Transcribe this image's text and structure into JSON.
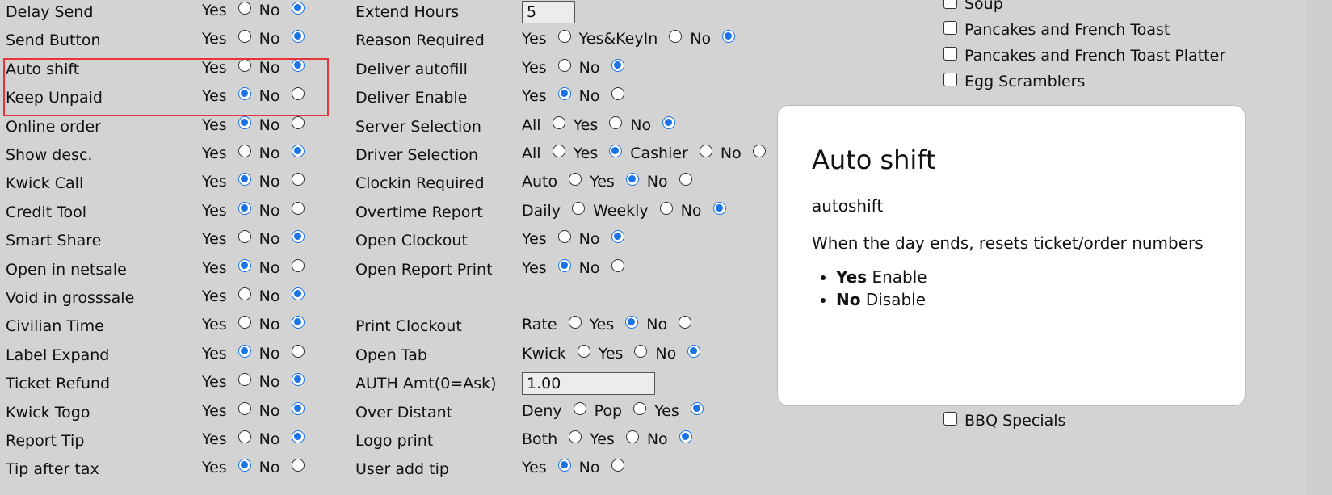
{
  "left_rows": [
    {
      "label": "Delay Send",
      "yes": "Yes",
      "no": "No",
      "selected": "no"
    },
    {
      "label": "Send Button",
      "yes": "Yes",
      "no": "No",
      "selected": "no"
    },
    {
      "label": "Auto shift",
      "yes": "Yes",
      "no": "No",
      "selected": "no"
    },
    {
      "label": "Keep Unpaid",
      "yes": "Yes",
      "no": "No",
      "selected": "yes"
    },
    {
      "label": "Online order",
      "yes": "Yes",
      "no": "No",
      "selected": "yes"
    },
    {
      "label": "Show desc.",
      "yes": "Yes",
      "no": "No",
      "selected": "no"
    },
    {
      "label": "Kwick Call",
      "yes": "Yes",
      "no": "No",
      "selected": "yes"
    },
    {
      "label": "Credit Tool",
      "yes": "Yes",
      "no": "No",
      "selected": "yes"
    },
    {
      "label": "Smart Share",
      "yes": "Yes",
      "no": "No",
      "selected": "no"
    },
    {
      "label": "Open in netsale",
      "yes": "Yes",
      "no": "No",
      "selected": "yes"
    },
    {
      "label": "Void in grosssale",
      "yes": "Yes",
      "no": "No",
      "selected": "no"
    },
    {
      "label": "Civilian Time",
      "yes": "Yes",
      "no": "No",
      "selected": "no"
    },
    {
      "label": "Label Expand",
      "yes": "Yes",
      "no": "No",
      "selected": "yes"
    },
    {
      "label": "Ticket Refund",
      "yes": "Yes",
      "no": "No",
      "selected": "no"
    },
    {
      "label": "Kwick Togo",
      "yes": "Yes",
      "no": "No",
      "selected": "no"
    },
    {
      "label": "Report Tip",
      "yes": "Yes",
      "no": "No",
      "selected": "no"
    },
    {
      "label": "Tip after tax",
      "yes": "Yes",
      "no": "No",
      "selected": "yes"
    }
  ],
  "mid_rows": [
    {
      "label": "Extend Hours",
      "input": "5",
      "options": []
    },
    {
      "label": "Reason Required",
      "options": [
        {
          "label": "Yes",
          "on": false
        },
        {
          "label": "Yes&KeyIn",
          "on": false
        },
        {
          "label": "No",
          "on": true
        }
      ]
    },
    {
      "label": "Deliver autofill",
      "options": [
        {
          "label": "Yes",
          "on": false
        },
        {
          "label": "No",
          "on": true
        }
      ]
    },
    {
      "label": "Deliver Enable",
      "options": [
        {
          "label": "Yes",
          "on": true
        },
        {
          "label": "No",
          "on": false
        }
      ]
    },
    {
      "label": "Server Selection",
      "options": [
        {
          "label": "All",
          "on": false
        },
        {
          "label": "Yes",
          "on": false
        },
        {
          "label": "No",
          "on": true
        }
      ]
    },
    {
      "label": "Driver Selection",
      "options": [
        {
          "label": "All",
          "on": false
        },
        {
          "label": "Yes",
          "on": true
        },
        {
          "label": "Cashier",
          "on": false
        },
        {
          "label": "No",
          "on": false
        }
      ]
    },
    {
      "label": "Clockin Required",
      "options": [
        {
          "label": "Auto",
          "on": false
        },
        {
          "label": "Yes",
          "on": true
        },
        {
          "label": "No",
          "on": false
        }
      ]
    },
    {
      "label": "Overtime Report",
      "options": [
        {
          "label": "Daily",
          "on": false
        },
        {
          "label": "Weekly",
          "on": false
        },
        {
          "label": "No",
          "on": true
        }
      ]
    },
    {
      "label": "Open Clockout",
      "options": [
        {
          "label": "Yes",
          "on": false
        },
        {
          "label": "No",
          "on": true
        }
      ]
    },
    {
      "label": "Open Report Print",
      "options": [
        {
          "label": "Yes",
          "on": true
        },
        {
          "label": "No",
          "on": false
        }
      ]
    },
    {
      "label": "",
      "options": []
    },
    {
      "label": "Print Clockout",
      "options": [
        {
          "label": "Rate",
          "on": false
        },
        {
          "label": "Yes",
          "on": true
        },
        {
          "label": "No",
          "on": false
        }
      ]
    },
    {
      "label": "Open Tab",
      "options": [
        {
          "label": "Kwick",
          "on": false
        },
        {
          "label": "Yes",
          "on": false
        },
        {
          "label": "No",
          "on": true
        }
      ]
    },
    {
      "label": "AUTH Amt(0=Ask)",
      "input": "1.00",
      "options": []
    },
    {
      "label": "Over Distant",
      "options": [
        {
          "label": "Deny",
          "on": false
        },
        {
          "label": "Pop",
          "on": false
        },
        {
          "label": "Yes",
          "on": true
        }
      ]
    },
    {
      "label": "Logo print",
      "options": [
        {
          "label": "Both",
          "on": false
        },
        {
          "label": "Yes",
          "on": false
        },
        {
          "label": "No",
          "on": true
        }
      ]
    },
    {
      "label": "User add tip",
      "options": [
        {
          "label": "Yes",
          "on": true
        },
        {
          "label": "No",
          "on": false
        }
      ]
    }
  ],
  "menu_checklist": [
    {
      "label": "Soup",
      "checked": false
    },
    {
      "label": "Pancakes and French Toast",
      "checked": false
    },
    {
      "label": "Pancakes and French Toast Platter",
      "checked": false
    },
    {
      "label": "Egg Scramblers",
      "checked": false
    },
    {
      "label": "BBQ Specials",
      "checked": false
    }
  ],
  "popup": {
    "title": "Auto shift",
    "key": "autoshift",
    "description": "When the day ends, resets ticket/order numbers",
    "items": [
      {
        "term": "Yes",
        "text": "Enable"
      },
      {
        "term": "No",
        "text": "Disable"
      }
    ]
  },
  "colors": {
    "accent": "#1a73e8",
    "highlight": "#e5343a",
    "background": "#d3d3d3"
  }
}
